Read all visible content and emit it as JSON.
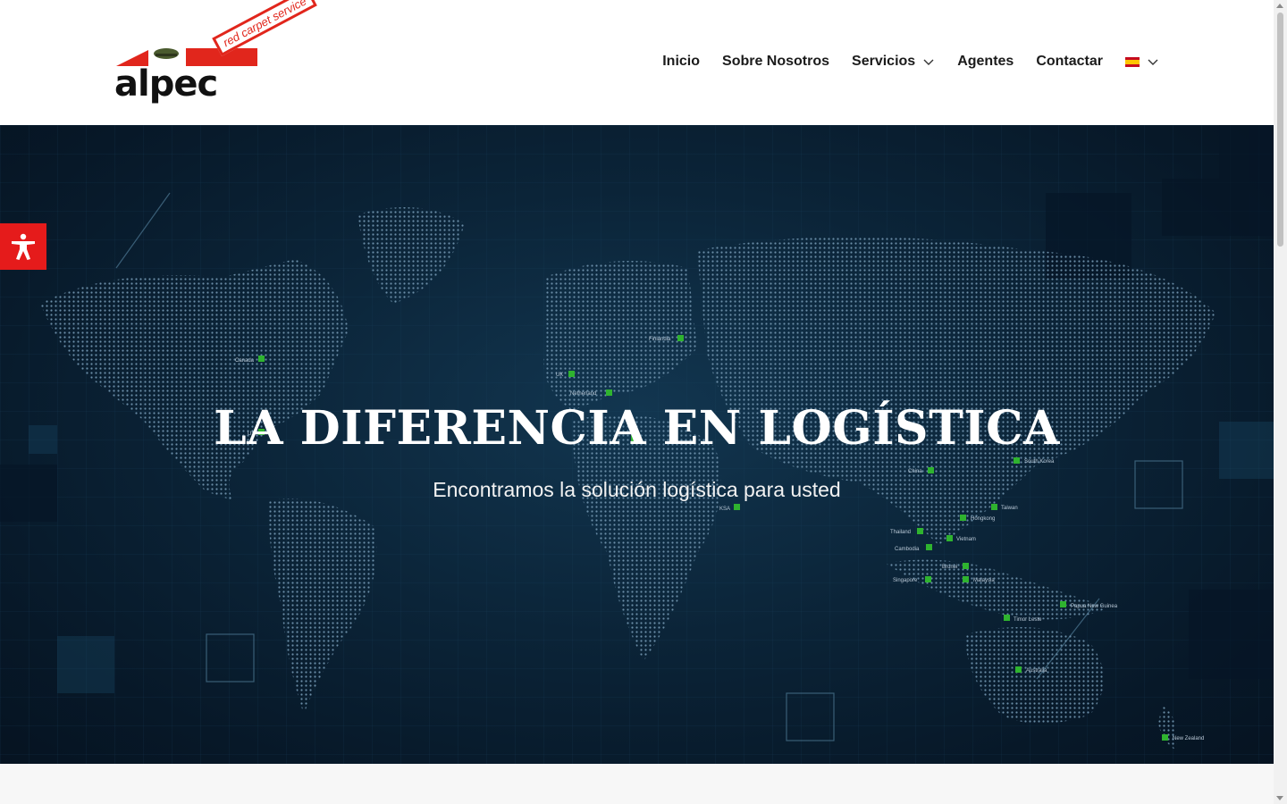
{
  "logo": {
    "word": "alpec",
    "tagline": "red carpet service"
  },
  "nav": {
    "items": [
      {
        "label": "Inicio",
        "dropdown": false
      },
      {
        "label": "Sobre Nosotros",
        "dropdown": false
      },
      {
        "label": "Servicios",
        "dropdown": true
      },
      {
        "label": "Agentes",
        "dropdown": false
      },
      {
        "label": "Contactar",
        "dropdown": false
      }
    ],
    "language": {
      "flag": "spain-flag-icon",
      "dropdown": true
    }
  },
  "hero": {
    "title": "LA DIFERENCIA EN LOGÍSTICA",
    "subtitle": "Encontramos la solución logística para usted",
    "map_markers": [
      "Finlandia",
      "Canada",
      "UK",
      "Netherland",
      "US",
      "China",
      "South Korea",
      "KSA",
      "Taiwan",
      "Hongkong",
      "Thailand",
      "Vietnam",
      "Cambodia",
      "Brunei",
      "Singapore",
      "Malaysia",
      "Papua New Guinea",
      "Timor Leste",
      "Australia",
      "New Zealand"
    ]
  },
  "accessibility": {
    "icon": "accessibility-icon"
  },
  "colors": {
    "brand_red": "#e51b1b",
    "hero_bg": "#0b2438",
    "marker_green": "#2fb32f"
  }
}
